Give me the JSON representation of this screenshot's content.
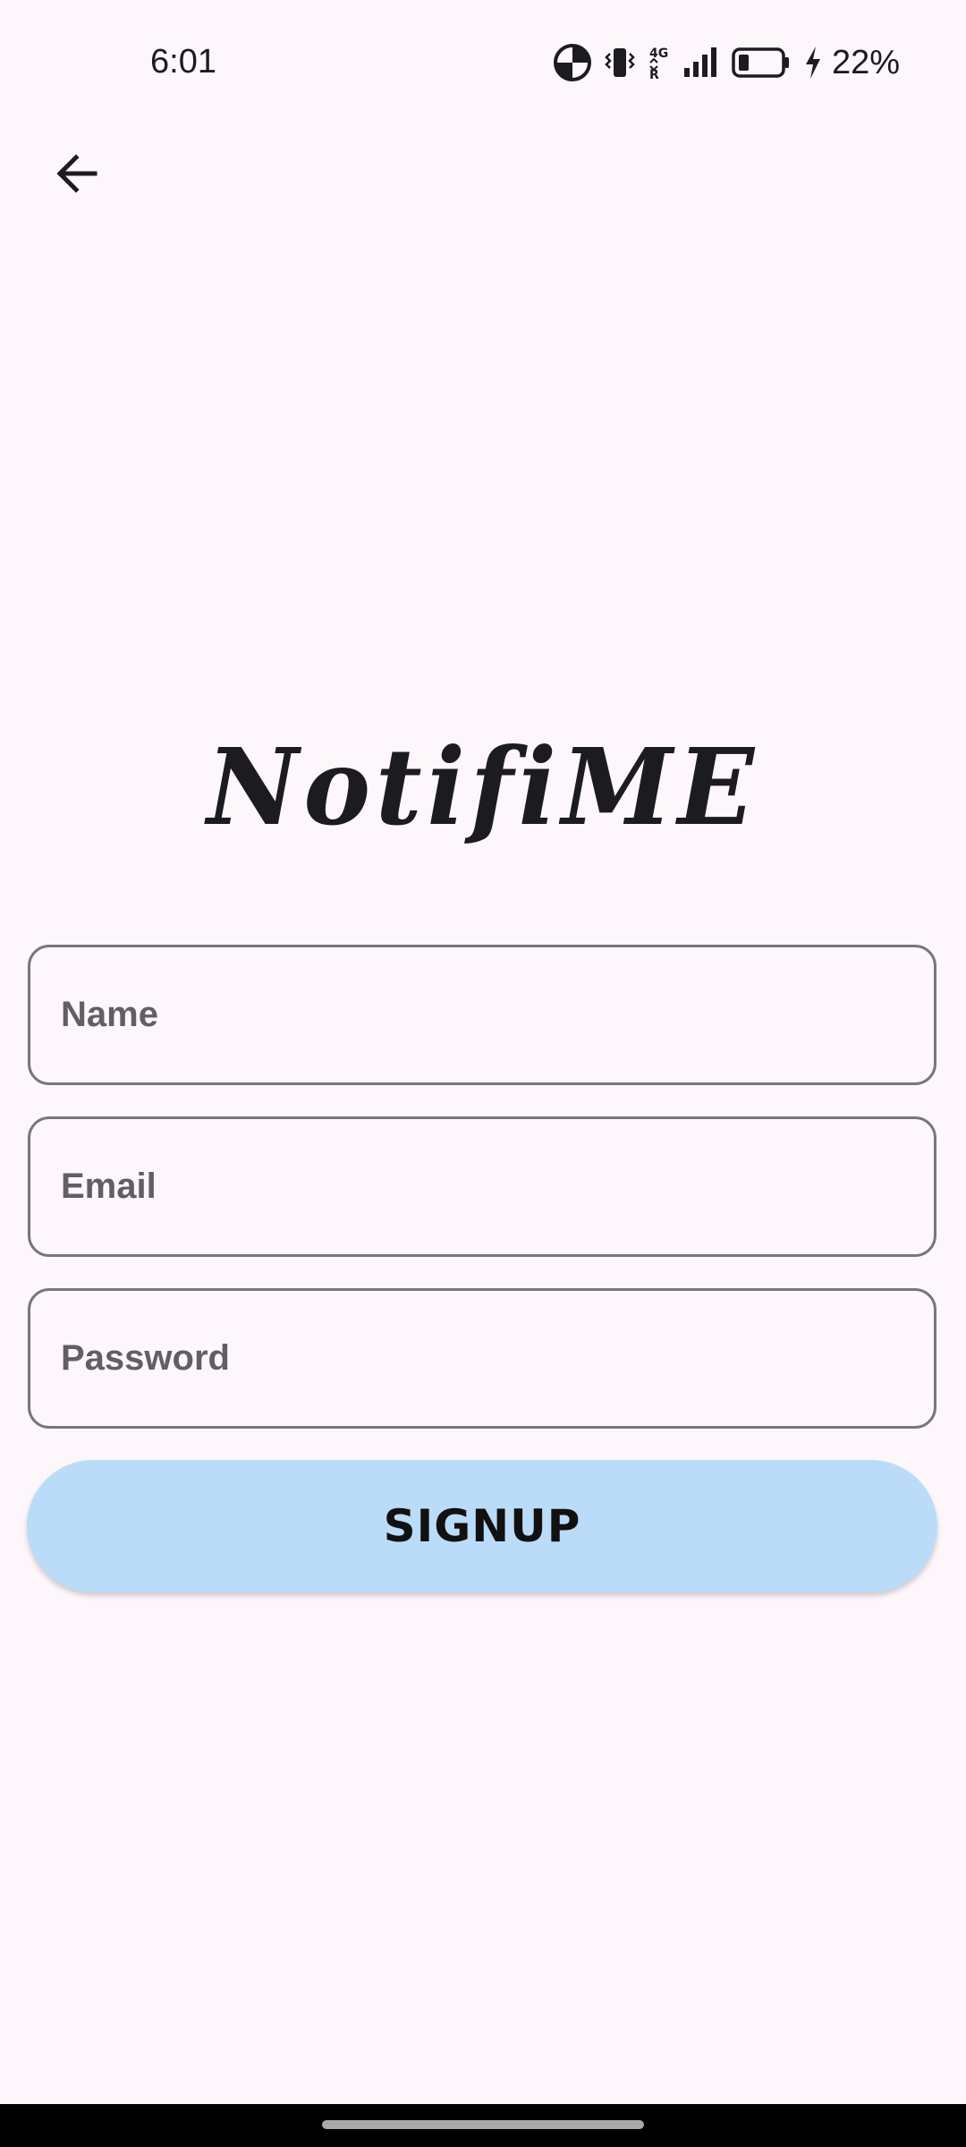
{
  "status_bar": {
    "time": "6:01",
    "battery_percent": "22%",
    "icons": [
      "data-saver-icon",
      "vibrate-icon",
      "network-4g-icon",
      "signal-icon",
      "battery-icon",
      "charging-icon"
    ]
  },
  "header": {
    "back_icon": "arrow-left-icon"
  },
  "logo": {
    "text": "NotifiME"
  },
  "form": {
    "name_placeholder": "Name",
    "email_placeholder": "Email",
    "password_placeholder": "Password",
    "name_value": "",
    "email_value": "",
    "password_value": "",
    "signup_label": "SIGNUP"
  },
  "colors": {
    "background": "#fdf7fc",
    "button": "#bbdcf8",
    "outline": "#79747e",
    "text": "#1c1b1f"
  }
}
